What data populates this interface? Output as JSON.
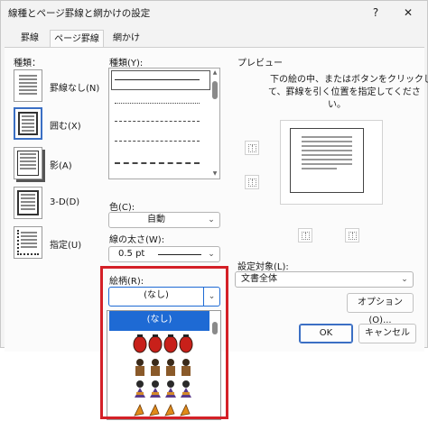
{
  "dialog": {
    "title": "線種とページ罫線と網かけの設定",
    "help": "?",
    "close": "✕"
  },
  "tabs": [
    {
      "label": "罫線"
    },
    {
      "label": "ページ罫線"
    },
    {
      "label": "網かけ"
    }
  ],
  "settings": {
    "label": "種類：",
    "items": [
      {
        "label": "罫線なし(N)"
      },
      {
        "label": "囲む(X)"
      },
      {
        "label": "影(A)"
      },
      {
        "label": "3-D(D)"
      },
      {
        "label": "指定(U)"
      }
    ]
  },
  "style": {
    "label": "種類(Y):"
  },
  "color": {
    "label": "色(C):",
    "value": "自動"
  },
  "width": {
    "label": "線の太さ(W):",
    "value": "0.5 pt"
  },
  "art": {
    "label": "絵柄(R):",
    "value": "(なし)",
    "selected_option": "(なし)"
  },
  "preview": {
    "label": "プレビュー",
    "instruction_line1": "下の絵の中、またはボタンをクリックし",
    "instruction_line2": "て、罫線を引く位置を指定してくださ",
    "instruction_line3": "い。"
  },
  "apply_to": {
    "label": "設定対象(L):",
    "value": "文書全体"
  },
  "buttons": {
    "options": "オプション(O)...",
    "ok": "OK",
    "cancel": "キャンセル"
  },
  "colors": {
    "accent": "#1e6ad4",
    "highlight": "#d42027"
  }
}
